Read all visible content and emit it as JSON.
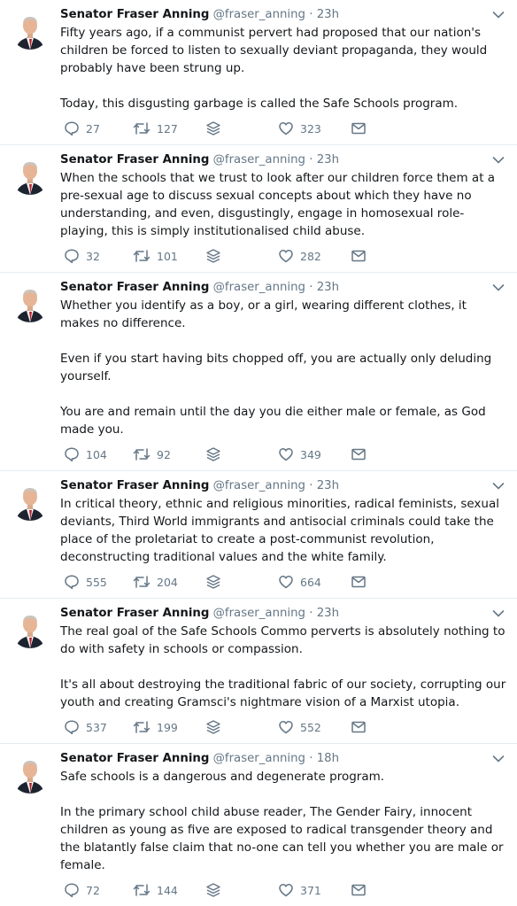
{
  "colors": {
    "text": "#14171a",
    "muted": "#657786",
    "divider": "#e6ecf0"
  },
  "tweets": [
    {
      "name": "Senator Fraser Anning",
      "handle": "@fraser_anning",
      "separator": "·",
      "time": "23h",
      "paragraphs": [
        "Fifty years ago, if a communist pervert had proposed that our nation's children be forced to listen to sexually deviant propaganda, they would probably have been strung up.",
        "Today, this disgusting garbage is called the Safe Schools program."
      ],
      "replies": "27",
      "retweets": "127",
      "likes": "323"
    },
    {
      "name": "Senator Fraser Anning",
      "handle": "@fraser_anning",
      "separator": "·",
      "time": "23h",
      "paragraphs": [
        "When the schools that we trust to look after our children force them at a pre-sexual age to discuss sexual concepts about which they have no understanding, and even, disgustingly, engage in homosexual role- playing, this is simply institutionalised child abuse."
      ],
      "replies": "32",
      "retweets": "101",
      "likes": "282"
    },
    {
      "name": "Senator Fraser Anning",
      "handle": "@fraser_anning",
      "separator": "·",
      "time": "23h",
      "paragraphs": [
        "Whether you identify as a boy, or a girl, wearing different clothes, it makes no difference.",
        "Even if you start having bits chopped off, you are actually only deluding yourself.",
        "You are and remain until the day you die either male or female, as God made you."
      ],
      "replies": "104",
      "retweets": "92",
      "likes": "349"
    },
    {
      "name": "Senator Fraser Anning",
      "handle": "@fraser_anning",
      "separator": "·",
      "time": "23h",
      "paragraphs": [
        "In critical theory, ethnic and religious minorities, radical feminists, sexual deviants, Third World immigrants and antisocial criminals could take the place of the proletariat to create a post-communist revolution, deconstructing traditional values and the white family."
      ],
      "replies": "555",
      "retweets": "204",
      "likes": "664"
    },
    {
      "name": "Senator Fraser Anning",
      "handle": "@fraser_anning",
      "separator": "·",
      "time": "23h",
      "paragraphs": [
        "The real goal of the Safe Schools Commo perverts is absolutely nothing to do with safety in schools or compassion.",
        "It's all about destroying the traditional fabric of our society, corrupting our youth and creating Gramsci's nightmare vision of a Marxist utopia."
      ],
      "replies": "537",
      "retweets": "199",
      "likes": "552"
    },
    {
      "name": "Senator Fraser Anning",
      "handle": "@fraser_anning",
      "separator": "·",
      "time": "18h",
      "paragraphs": [
        "Safe schools is a dangerous and degenerate program.",
        "In the primary school child abuse reader, The Gender Fairy, innocent children as young as five are exposed to radical transgender theory and the blatantly false claim that no-one can tell you whether you are male or female."
      ],
      "replies": "72",
      "retweets": "144",
      "likes": "371"
    }
  ],
  "icons": {
    "avatar": "profile-photo",
    "caret": "chevron-down-icon",
    "reply": "reply-icon",
    "retweet": "retweet-icon",
    "stack": "stack-icon",
    "like": "heart-icon",
    "dm": "envelope-icon"
  }
}
